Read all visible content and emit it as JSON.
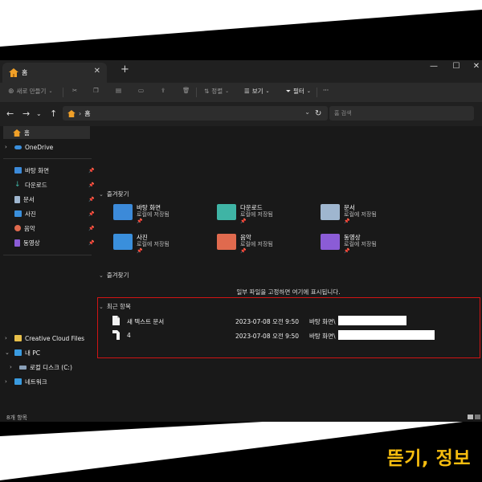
{
  "window": {
    "tab_title": "홈",
    "new_tab": "+",
    "close_tab": "✕",
    "controls": [
      "—",
      "☐",
      "✕"
    ]
  },
  "toolbar": {
    "new": "새로 만들기",
    "sort": "정렬",
    "view": "보기",
    "filter": "필터",
    "more": "···"
  },
  "address": {
    "path": "홈",
    "search_placeholder": "홈 검색"
  },
  "nav_pane": {
    "home": "홈",
    "onedrive": "OneDrive",
    "pinned": [
      {
        "label": "바탕 화면",
        "icon": "desktop-icon",
        "color": "#3c8ad9"
      },
      {
        "label": "다운로드",
        "icon": "download-icon",
        "color": "#3fb4a5"
      },
      {
        "label": "문서",
        "icon": "document-icon",
        "color": "#9fb6cf"
      },
      {
        "label": "사진",
        "icon": "pictures-icon",
        "color": "#3a8fdc"
      },
      {
        "label": "음악",
        "icon": "music-icon",
        "color": "#e06a4e"
      },
      {
        "label": "동영상",
        "icon": "video-icon",
        "color": "#8b5cd6"
      }
    ],
    "creative_cloud": "Creative Cloud Files",
    "this_pc": "내 PC",
    "local_disk": "로컬 디스크 (C:)",
    "network": "네트워크"
  },
  "content": {
    "quick_access_header": "즐겨찾기",
    "quick_access": [
      {
        "name": "바탕 화면",
        "sub": "로컬에 저장됨",
        "icon": "desktop-folder-icon",
        "color": "#3c8ad9"
      },
      {
        "name": "다운로드",
        "sub": "로컬에 저장됨",
        "icon": "downloads-folder-icon",
        "color": "#3fb4a5"
      },
      {
        "name": "문서",
        "sub": "로컬에 저장됨",
        "icon": "documents-folder-icon",
        "color": "#9fb6cf"
      },
      {
        "name": "사진",
        "sub": "로컬에 저장됨",
        "icon": "pictures-folder-icon",
        "color": "#3a8fdc"
      },
      {
        "name": "음악",
        "sub": "로컬에 저장됨",
        "icon": "music-folder-icon",
        "color": "#e06a4e"
      },
      {
        "name": "동영상",
        "sub": "로컬에 저장됨",
        "icon": "videos-folder-icon",
        "color": "#8b5cd6"
      }
    ],
    "favorites_header": "즐겨찾기",
    "favorites_hint": "일부 파일을 고정하면 여기에 표시됩니다.",
    "recent_header": "최근 항목",
    "recent": [
      {
        "name": "새 텍스트 문서",
        "date": "2023-07-08 오전 9:50",
        "location": "바탕 화면\\"
      },
      {
        "name": "4",
        "date": "2023-07-08 오전 9:50",
        "location": "바탕 화면\\"
      }
    ]
  },
  "status": {
    "count": "8개 항목"
  },
  "brand": {
    "text": "뜯기, 정보",
    "color": "#f6bd0f"
  }
}
